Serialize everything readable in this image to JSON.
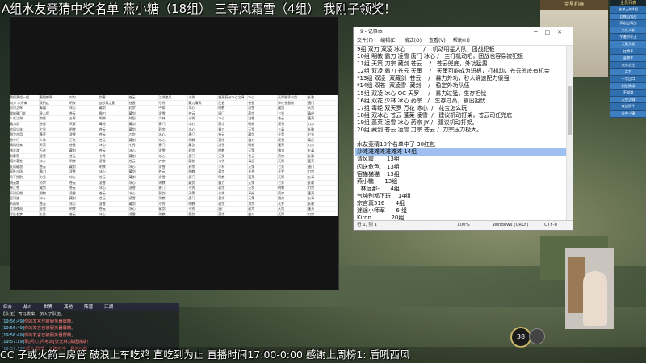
{
  "banner": "A组水友竞猜中奖名单 燕小糖（18组） 三寺风霜雪（4组） 我刚子领奖！",
  "notepad": {
    "title": "9 - 记事本",
    "menu": [
      "文件(F)",
      "编辑(E)",
      "格式(O)",
      "查看(V)",
      "帮助(H)"
    ],
    "lines": [
      "9组 双刀 双凌 冰心          /    机动明星大队，团战犯板",
      "10组 明教 霸刀 凌雪 唐门 冰心 /   主打机动吧，团战也容易被犯板",
      "11组 天策 刀宗 藏剑 苍云    /   苍云兜底，外功猛男",
      "12组 双凌 霸刀 苍云 天策    /   天策可能成为短板，打机动，苍云兜底有机会",
      "*13组 双凌  双藏剑  苍云    /   暴力外功，秒人确速配力很强",
      "*14组 双苍  双凌雪  藏剑    /   稳定外功队伍",
      "15组 双凌 冰心 QC 天罗     /   暴力过猛，生存担忧",
      "16组 双花 少林 冰心 药宗   /   生存过高，输出担忧",
      "17组 毒经 双天罗 万花 冰心  /   花宝怎么玩",
      "18组 双冰心 苍云 蓬莱 凌雪  /   建议机动打架，苍云司任兜底",
      "19组 蓬莱 凌雪 冰心 药宗 JY /   建议机动打架。",
      "20组 藏剑 苍云 凌雪 刀宗 苍云 /  刀宗压力极大。",
      "",
      "水友竞猜10个名单中了 30红包",
      "沙滩滩滩滩滩滩滩 14组",
      "清风霞：    13组",
      "闪送危色    13组",
      "宿猫猫猫    13组",
      "燕小糖      13组",
      "  林远那-      4组",
      "气纯别都下玩    14组",
      "宗宫真516      4组",
      "迷途小师军      6 组",
      "Kiron           20组"
    ],
    "highlight_index": 14,
    "status": {
      "pos": "行 1, 列 1",
      "zoom": "100%",
      "eol": "Windows (CRLF)",
      "enc": "UTF-8"
    }
  },
  "sheet": {
    "rows": [
      [
        "我们赛组一组",
        "凝霜射界",
        "对刀",
        "剑客",
        "苍云",
        "江湖追风",
        "七秀",
        "霞蒸蔚@冰心之晴",
        "冰心",
        "天策暖手小剑",
        "长歌"
      ],
      [
        "南方 水先锋",
        "双帆疾",
        "明教",
        "战长歌之影",
        "苍云",
        "七秀",
        "藏刀清风",
        "乱云",
        "苍云",
        "伊吐苍云棱",
        "唐门"
      ],
      [
        "初月之晖",
        "毒霜",
        "冰心",
        "藏剑",
        "药宗",
        "丐帮",
        "冰心",
        "明教",
        "凌雪",
        "藏剑",
        "天策"
      ],
      [
        "我的雁门关",
        "寻人探",
        "苍云",
        "霸刀",
        "藏剑",
        "凌雪",
        "苍云",
        "唐门",
        "药宗",
        "七秀",
        "毒经"
      ],
      [
        "人在江湖",
        "寂然",
        "五毒",
        "明教",
        "纯阳",
        "少林",
        "七秀",
        "冰心",
        "凌雪",
        "苍云",
        "蓬莱"
      ],
      [
        "霸刀流",
        "苍云",
        "天策",
        "毒经",
        "藏剑",
        "唐门",
        "冰心",
        "药宗",
        "明教",
        "凌雪",
        "刀宗"
      ],
      [
        "追风少年",
        "七秀",
        "明教",
        "苍云",
        "藏剑",
        "药宗",
        "冰心",
        "霸刀",
        "天罗",
        "五毒",
        "长歌"
      ],
      [
        "潜龙勿用",
        "蓬莱",
        "凌雪",
        "苍云",
        "刀宗",
        "冰心",
        "唐门",
        "苍云",
        "藏剑",
        "天策",
        "七秀"
      ],
      [
        "雪中行",
        "少林",
        "万花",
        "苍云",
        "藏剑",
        "冰心",
        "明教",
        "药宗",
        "霸刀",
        "凌雪",
        "毒经"
      ],
      [
        "清风徐来",
        "天策",
        "苍云",
        "冰心",
        "七秀",
        "唐门",
        "藏剑",
        "凌雪",
        "明教",
        "蓬莱",
        "刀宗"
      ],
      [
        "桃花渡",
        "万花",
        "藏剑",
        "苍云",
        "冰心",
        "凌雪",
        "药宗",
        "明教",
        "天策",
        "霸刀",
        "五毒"
      ],
      [
        "剑影寒",
        "凌雪",
        "苍云",
        "七秀",
        "藏剑",
        "冰心",
        "唐门",
        "天罗",
        "苍云",
        "药宗",
        "长歌"
      ],
      [
        "孤舟蓑笠",
        "冰心",
        "明教",
        "凌雪",
        "苍云",
        "刀宗",
        "藏剑",
        "七秀",
        "毒经",
        "天策",
        "蓬莱"
      ],
      [
        "长风破浪",
        "苍云",
        "藏剑",
        "明教",
        "冰心",
        "凌雪",
        "药宗",
        "少林",
        "天策",
        "七秀",
        "唐门"
      ],
      [
        "醉卧沙场",
        "霸刀",
        "凌雪",
        "冰心",
        "藏剑",
        "苍云",
        "明教",
        "药宗",
        "七秀",
        "天罗",
        "刀宗"
      ],
      [
        "月下独酌",
        "七秀",
        "冰心",
        "苍云",
        "藏剑",
        "凌雪",
        "唐门",
        "明教",
        "蓬莱",
        "天策",
        "五毒"
      ],
      [
        "流云散",
        "药宗",
        "苍云",
        "凌雪",
        "冰心",
        "明教",
        "藏剑",
        "霸刀",
        "天策",
        "七秀",
        "长歌"
      ],
      [
        "寒江雪",
        "藏剑",
        "苍云",
        "冰心",
        "凌雪",
        "唐门",
        "七秀",
        "药宗",
        "天罗",
        "明教",
        "刀宗"
      ],
      [
        "不问归期",
        "明教",
        "凌雪",
        "苍云",
        "冰心",
        "藏剑",
        "天策",
        "七秀",
        "毒经",
        "药宗",
        "蓬莱"
      ],
      [
        "星河渡",
        "冰心",
        "藏剑",
        "苍云",
        "凌雪",
        "明教",
        "唐门",
        "药宗",
        "天策",
        "霸刀",
        "五毒"
      ],
      [
        "听雨轩",
        "苍云",
        "冰心",
        "凌雪",
        "藏剑",
        "七秀",
        "明教",
        "药宗",
        "刀宗",
        "天罗",
        "长歌"
      ],
      [
        "江湖夜雨",
        "凌雪",
        "明教",
        "苍云",
        "冰心",
        "藏剑",
        "七秀",
        "唐门",
        "药宗",
        "天策",
        "蓬莱"
      ],
      [
        "浮生若梦",
        "七秀",
        "苍云",
        "冰心",
        "凌雪",
        "明教",
        "藏剑",
        "药宗",
        "霸刀",
        "天策",
        "刀宗"
      ],
      [
        "青衫客",
        "藏剑",
        "冰心",
        "凌雪",
        "苍云",
        "唐门",
        "明教",
        "七秀",
        "药宗",
        "天罗",
        "毒经"
      ],
      [
        "明月照我",
        "苍云",
        "凌雪",
        "明教",
        "冰心",
        "藏剑",
        "七秀",
        "药宗",
        "天策",
        "刀宗",
        "五毒"
      ],
      [
        "归去来",
        "冰心",
        "苍云",
        "藏剑",
        "凌雪",
        "明教",
        "唐门",
        "七秀",
        "药宗",
        "霸刀",
        "长歌"
      ]
    ]
  },
  "right_panel": {
    "header": "全员列表",
    "items": [
      "名单上的A组",
      "巨铁山驾战",
      "高岩山驾战",
      "大众人杉",
      "宁者尔小玉",
      "天策开发",
      "红牌手",
      "蓝牌手",
      "大众之主",
      "北方",
      "十字山口",
      "剑侠情缘",
      "不知道",
      "天空之城",
      "夜战双牛",
      "半空一锤"
    ]
  },
  "minimap": {
    "header": "金星利器"
  },
  "chat": {
    "tabs": [
      "综合",
      "战斗",
      "世界",
      "其他",
      "阵营",
      "江湖"
    ],
    "lines": [
      {
        "time": "",
        "text": "·【队伍】司马发来：加入了队伍。"
      },
      {
        "time": "[19:56:49]",
        "text": "你的发言已被服务器屏蔽。"
      },
      {
        "time": "[19:56:49]",
        "text": "你的发言已被服务器屏蔽。"
      },
      {
        "time": "[19:56:49]",
        "text": "你的发言已被服务器屏蔽。"
      },
      {
        "time": "[19:57:19]",
        "text": "军[闪心]闪电向[张光林]发起挑战！"
      },
      {
        "time": "[19:57:19]",
        "text": "[帮会]阵营：天策府中，相关功能"
      }
    ]
  },
  "hud": {
    "level": "38"
  },
  "ticker": "CC 子或火箭=房管 破浪上车吃鸡 直吃到为止 直播时间17:00-0:00 感谢上周榜1: 盾吼西风"
}
